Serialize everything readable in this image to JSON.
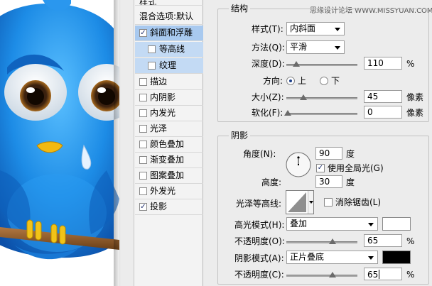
{
  "watermark": "思缘设计论坛 WWW.MISSYUAN.COM",
  "style_list": {
    "header": "样式",
    "blend_options": "混合选项:默认",
    "items": [
      {
        "label": "斜面和浮雕",
        "checked": true
      },
      {
        "label": "等高线",
        "checked": false
      },
      {
        "label": "纹理",
        "checked": false
      },
      {
        "label": "描边",
        "checked": false
      },
      {
        "label": "内阴影",
        "checked": false
      },
      {
        "label": "内发光",
        "checked": false
      },
      {
        "label": "光泽",
        "checked": false
      },
      {
        "label": "颜色叠加",
        "checked": false
      },
      {
        "label": "渐变叠加",
        "checked": false
      },
      {
        "label": "图案叠加",
        "checked": false
      },
      {
        "label": "外发光",
        "checked": false
      },
      {
        "label": "投影",
        "checked": true
      }
    ]
  },
  "structure": {
    "title": "结构",
    "style_label": "样式(T):",
    "style_value": "内斜面",
    "method_label": "方法(Q):",
    "method_value": "平滑",
    "depth_label": "深度(D):",
    "depth_value": "110",
    "depth_unit": "%",
    "direction_label": "方向:",
    "direction_up": "上",
    "direction_down": "下",
    "size_label": "大小(Z):",
    "size_value": "45",
    "size_unit": "像素",
    "soften_label": "软化(F):",
    "soften_value": "0",
    "soften_unit": "像素"
  },
  "shading": {
    "title": "阴影",
    "angle_label": "角度(N):",
    "angle_value": "90",
    "angle_unit": "度",
    "global_light_label": "使用全局光(G)",
    "global_light_checked": true,
    "altitude_label": "高度:",
    "altitude_value": "30",
    "altitude_unit": "度",
    "gloss_contour_label": "光泽等高线:",
    "anti_alias_label": "消除锯齿(L)",
    "anti_alias_checked": false,
    "highlight_mode_label": "高光模式(H):",
    "highlight_mode_value": "叠加",
    "highlight_color": "#ffffff",
    "highlight_opacity_label": "不透明度(O):",
    "highlight_opacity_value": "65",
    "highlight_opacity_unit": "%",
    "shadow_mode_label": "阴影模式(A):",
    "shadow_mode_value": "正片叠底",
    "shadow_color": "#000000",
    "shadow_opacity_label": "不透明度(C):",
    "shadow_opacity_value": "65",
    "shadow_opacity_unit": "%"
  },
  "colors": {
    "selected_row": "#a8c9ef",
    "bird_blue": "#1e8de6",
    "branch": "#8a5a2b",
    "feet": "#f2c318"
  }
}
